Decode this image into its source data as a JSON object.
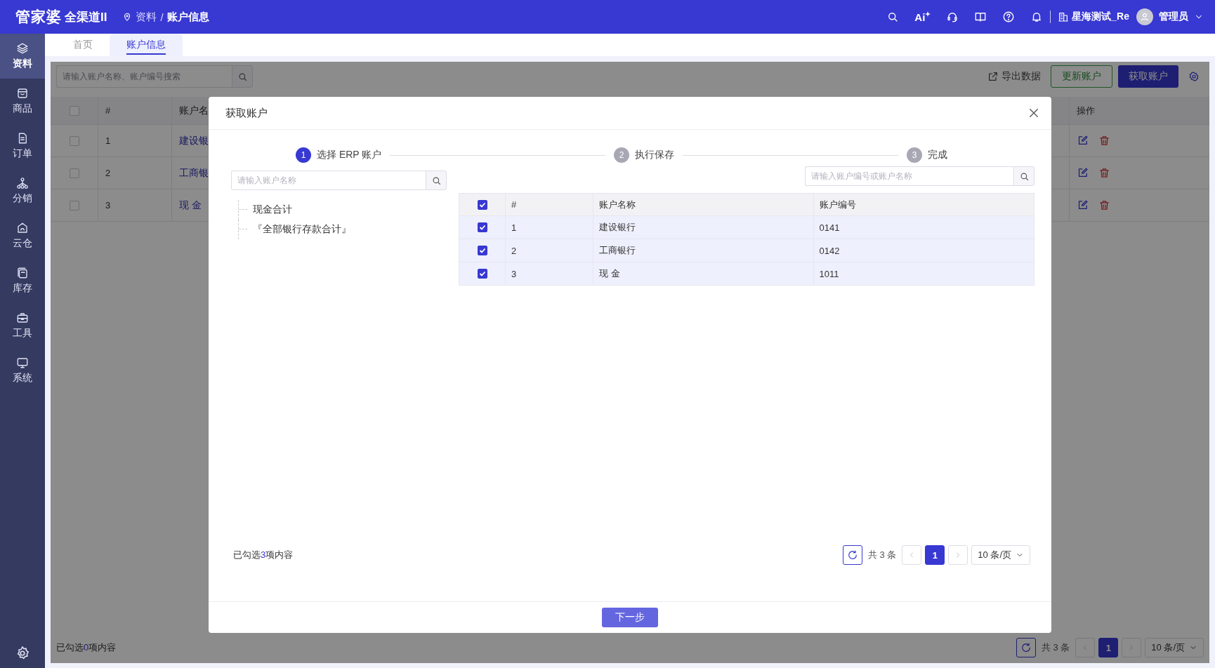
{
  "header": {
    "brand": "管家婆",
    "product": "全渠道II",
    "breadcrumb": [
      "资料",
      "账户信息"
    ],
    "breadcrumb_separator": "/",
    "ai_label": "Ai",
    "org": "星海测试_Re",
    "user": "管理员"
  },
  "sidebar": {
    "items": [
      {
        "label": "资料",
        "selected": true
      },
      {
        "label": "商品",
        "selected": false
      },
      {
        "label": "订单",
        "selected": false
      },
      {
        "label": "分销",
        "selected": false
      },
      {
        "label": "云仓",
        "selected": false
      },
      {
        "label": "库存",
        "selected": false
      },
      {
        "label": "工具",
        "selected": false
      },
      {
        "label": "系统",
        "selected": false
      }
    ]
  },
  "tabs": [
    {
      "label": "首页",
      "selected": false
    },
    {
      "label": "账户信息",
      "selected": true
    }
  ],
  "page": {
    "search": {
      "placeholder": "请输入账户名称、账户编号搜索"
    },
    "actions": {
      "export": "导出数据",
      "update": "更新账户",
      "fetch": "获取账户"
    },
    "table": {
      "all_checked": false,
      "columns": [
        "#",
        "账户名",
        "操作"
      ],
      "rows": [
        {
          "number": "1",
          "name": "建设银",
          "checked": false
        },
        {
          "number": "2",
          "name": "工商银",
          "checked": false
        },
        {
          "number": "3",
          "name": "现 金",
          "checked": false
        }
      ]
    },
    "summary": {
      "prefix": "已勾选",
      "count": "0",
      "suffix": "项内容"
    },
    "pager": {
      "total": "共 3 条",
      "pages": [
        {
          "label": "1",
          "selected": true
        }
      ],
      "page_size": "10 条/页"
    }
  },
  "dialog": {
    "title": "获取账户",
    "steps": [
      {
        "number": "1",
        "label": "选择 ERP 账户",
        "selected": true
      },
      {
        "number": "2",
        "label": "执行保存",
        "selected": false
      },
      {
        "number": "3",
        "label": "完成",
        "selected": false
      }
    ],
    "tree_search": {
      "placeholder": "请输入账户名称"
    },
    "tree": [
      {
        "label": "现金合计"
      },
      {
        "label": "『全部银行存款合计』"
      }
    ],
    "table_search": {
      "placeholder": "请输入账户编号或账户名称"
    },
    "table": {
      "all_checked": true,
      "columns": [
        "#",
        "账户名称",
        "账户编号"
      ],
      "rows": [
        {
          "number": "1",
          "name": "建设银行",
          "code": "0141",
          "checked": true
        },
        {
          "number": "2",
          "name": "工商银行",
          "code": "0142",
          "checked": true
        },
        {
          "number": "3",
          "name": "现 金",
          "code": "1011",
          "checked": true
        }
      ]
    },
    "summary": {
      "prefix": "已勾选",
      "count": "3",
      "suffix": "项内容"
    },
    "pager": {
      "total": "共 3 条",
      "pages": [
        {
          "label": "1",
          "selected": true
        }
      ],
      "page_size": "10 条/页"
    },
    "next_button": "下一步"
  }
}
